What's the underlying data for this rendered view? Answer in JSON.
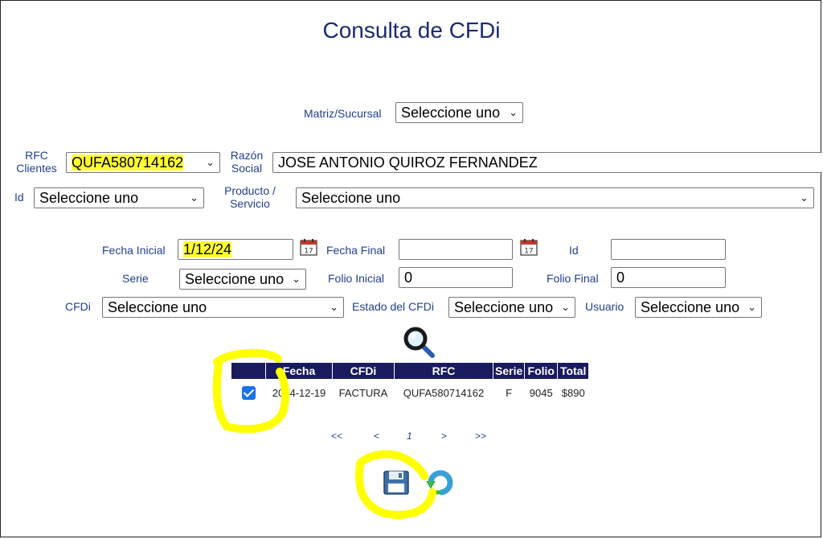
{
  "page": {
    "title": "Consulta de CFDi"
  },
  "filters": {
    "matriz_label": "Matriz/Sucursal",
    "matriz_value": "Seleccione uno",
    "rfc_label_1": "RFC",
    "rfc_label_2": "Clientes",
    "rfc_value": "QUFA580714162",
    "razon_label_1": "Razón",
    "razon_label_2": "Social",
    "razon_value": "JOSE ANTONIO QUIROZ FERNANDEZ",
    "id_label": "Id",
    "id_value": "Seleccione uno",
    "producto_label_1": "Producto /",
    "producto_label_2": "Servicio",
    "producto_value": "Seleccione uno",
    "fecha_inicial_label": "Fecha Inicial",
    "fecha_inicial_value": "1/12/24",
    "fecha_final_label": "Fecha Final",
    "fecha_final_value": "",
    "id2_label": "Id",
    "id2_value": "",
    "serie_label": "Serie",
    "serie_value": "Seleccione uno",
    "folio_inicial_label": "Folio Inicial",
    "folio_inicial_value": "0",
    "folio_final_label": "Folio Final",
    "folio_final_value": "0",
    "cfdi_label": "CFDi",
    "cfdi_value": "Seleccione uno",
    "estado_label": "Estado del CFDi",
    "estado_value": "Seleccione uno",
    "usuario_label": "Usuario",
    "usuario_value": "Seleccione uno",
    "calendar_day": "17"
  },
  "table": {
    "headers": [
      "",
      "Fecha",
      "CFDi",
      "RFC",
      "Serie",
      "Folio",
      "Total"
    ],
    "rows": [
      {
        "checked": true,
        "fecha": "2024-12-19",
        "cfdi": "FACTURA",
        "rfc": "QUFA580714162",
        "serie": "F",
        "folio": "9045",
        "total": "$890"
      }
    ]
  },
  "pager": {
    "first": "<<",
    "prev": "<",
    "page": "1",
    "next": ">",
    "last": ">>"
  },
  "icons": {
    "search": "magnifier-icon",
    "calendar": "calendar-icon",
    "save": "floppy-disk-icon",
    "refresh": "refresh-icon"
  },
  "colors": {
    "label": "#1f3f8f",
    "title": "#1b2a6e",
    "header_bg": "#1a1a5e",
    "highlight": "#ffff33"
  }
}
